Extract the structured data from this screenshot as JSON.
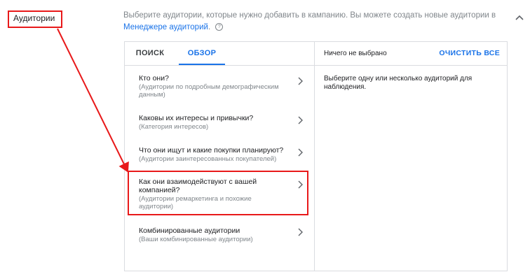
{
  "section": {
    "label": "Аудитории"
  },
  "description": {
    "text": "Выберите аудитории, которые нужно добавить в кампанию. Вы можете создать новые аудитории в ",
    "link": "Менеджере аудиторий",
    "suffix": ".",
    "help_icon": "?"
  },
  "tabs": [
    {
      "label": "ПОИСК",
      "active": false
    },
    {
      "label": "ОБЗОР",
      "active": true
    }
  ],
  "categories": [
    {
      "title": "Кто они?",
      "subtitle": "(Аудитории по подробным демографическим данным)"
    },
    {
      "title": "Каковы их интересы и привычки?",
      "subtitle": "(Категория интересов)"
    },
    {
      "title": "Что они ищут и какие покупки планируют?",
      "subtitle": "(Аудитории заинтересованных покупателей)"
    },
    {
      "title": "Как они взаимодействуют с вашей компанией?",
      "subtitle": "(Аудитории ремаркетинга и похожие аудитории)"
    },
    {
      "title": "Комбинированные аудитории",
      "subtitle": "(Ваши комбинированные аудитории)"
    }
  ],
  "selection": {
    "status": "Ничего не выбрано",
    "clear_all": "ОЧИСТИТЬ ВСЕ",
    "hint": "Выберите одну или несколько аудиторий для наблюдения."
  },
  "annotation_color": "#e8191a",
  "accent_color": "#1a73e8"
}
